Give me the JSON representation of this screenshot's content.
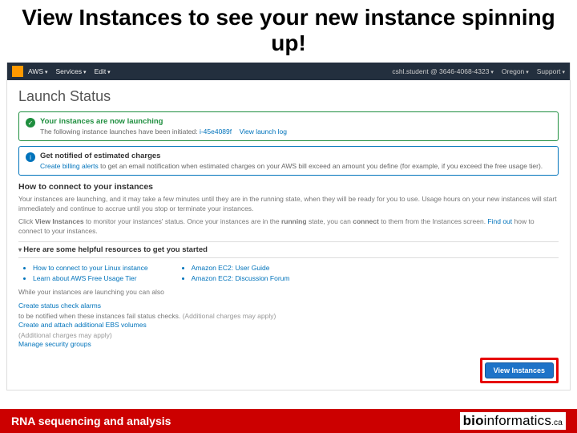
{
  "slide_title": "View Instances to see your new instance spinning up!",
  "navbar": {
    "aws_label": "AWS",
    "services_label": "Services",
    "edit_label": "Edit",
    "account_label": "cshl.student @ 3646-4068-4323",
    "region_label": "Oregon",
    "support_label": "Support"
  },
  "launch_status_heading": "Launch Status",
  "success_alert": {
    "title": "Your instances are now launching",
    "prefix": "The following instance launches have been initiated: ",
    "instance_id": "i-45e4089f",
    "view_log": "View launch log"
  },
  "info_alert": {
    "title": "Get notified of estimated charges",
    "text_prefix": "Create billing alerts",
    "text_rest": " to get an email notification when estimated charges on your AWS bill exceed an amount you define (for example, if you exceed the free usage tier)."
  },
  "connect_heading": "How to connect to your instances",
  "connect_p1": "Your instances are launching, and it may take a few minutes until they are in the running state, when they will be ready for you to use. Usage hours on your new instances will start immediately and continue to accrue until you stop or terminate your instances.",
  "connect_p2_a": "Click ",
  "connect_p2_b": "View Instances",
  "connect_p2_c": " to monitor your instances' status. Once your instances are in the ",
  "connect_p2_d": "running",
  "connect_p2_e": " state, you can ",
  "connect_p2_f": "connect",
  "connect_p2_g": " to them from the Instances screen. ",
  "connect_p2_findout": "Find out",
  "connect_p2_h": " how to connect to your instances.",
  "resources_heading": "Here are some helpful resources to get you started",
  "resources_col1": [
    "How to connect to your Linux instance",
    "Learn about AWS Free Usage Tier"
  ],
  "resources_col2": [
    "Amazon EC2: User Guide",
    "Amazon EC2: Discussion Forum"
  ],
  "while_launching": "While your instances are launching you can also",
  "extra_links": {
    "l1a": "Create status check alarms",
    "l1b": " to be notified when these instances fail status checks. ",
    "l1c": "(Additional charges may apply)",
    "l2a": "Create and attach additional EBS volumes",
    "l2b": " (Additional charges may apply)",
    "l3": "Manage security groups"
  },
  "view_instances_btn": "View Instances",
  "footer": {
    "left": "RNA sequencing and analysis",
    "right_bold": "bio",
    "right_rest": "informatics",
    "right_ca": ".ca"
  }
}
